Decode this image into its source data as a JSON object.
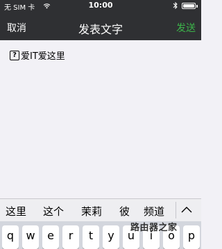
{
  "status_bar": {
    "carrier": "无 SIM 卡",
    "time": "10:00"
  },
  "nav": {
    "cancel_label": "取消",
    "title": "发表文字",
    "send_label": "发送",
    "send_color": "#3cb44a"
  },
  "compose": {
    "icon_glyph": "?",
    "text": "爱IT爱这里"
  },
  "suggestions": [
    "这里",
    "这个",
    "茉莉",
    "彼",
    "频道"
  ],
  "keyboard": {
    "row1": [
      "q",
      "w",
      "e",
      "r",
      "t",
      "y",
      "u",
      "i",
      "o",
      "p"
    ]
  },
  "watermark": "路由器之家"
}
